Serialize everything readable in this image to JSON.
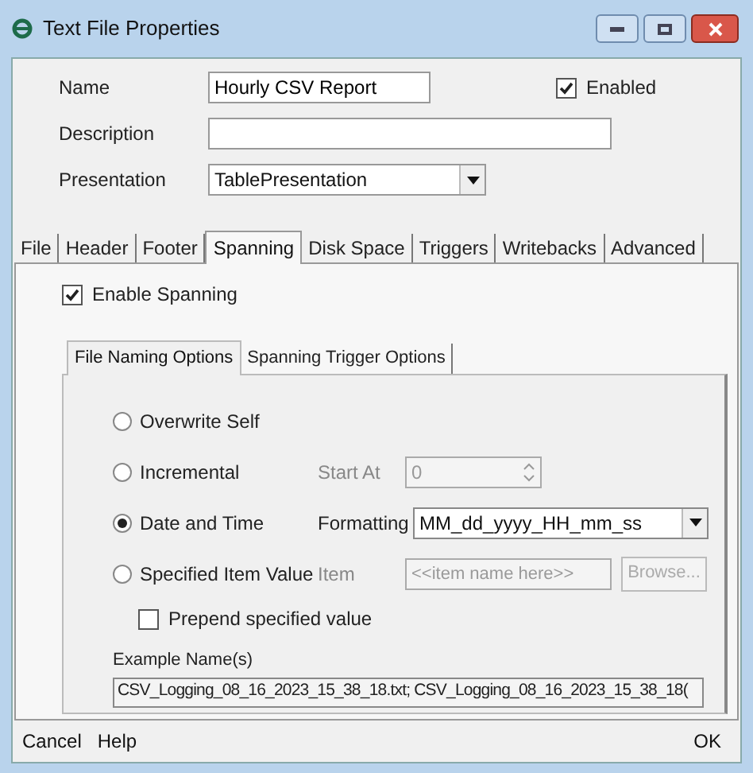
{
  "window": {
    "title": "Text File Properties"
  },
  "fields": {
    "name_label": "Name",
    "name_value": "Hourly CSV Report",
    "enabled_label": "Enabled",
    "enabled_checked": true,
    "description_label": "Description",
    "presentation_label": "Presentation",
    "presentation_value": "TablePresentation"
  },
  "tabs": [
    {
      "label": "File",
      "selected": false
    },
    {
      "label": "Header",
      "selected": false
    },
    {
      "label": "Footer",
      "selected": false
    },
    {
      "label": "Spanning",
      "selected": true
    },
    {
      "label": "Disk Space",
      "selected": false
    },
    {
      "label": "Triggers",
      "selected": false
    },
    {
      "label": "Writebacks",
      "selected": false
    },
    {
      "label": "Advanced",
      "selected": false
    }
  ],
  "enable_spanning": {
    "label": "Enable Spanning",
    "checked": true
  },
  "inner_tabs": [
    {
      "label": "File Naming Options",
      "selected": true
    },
    {
      "label": "Spanning Trigger Options",
      "selected": false
    }
  ],
  "naming_options": [
    {
      "label": "Overwrite Self",
      "selected": false,
      "kind": "none"
    },
    {
      "label": "Incremental",
      "selected": false,
      "kind": "spinner",
      "control_label": "Start At",
      "value": "0"
    },
    {
      "label": "Date and Time",
      "selected": true,
      "kind": "dropdown",
      "control_label": "Formatting",
      "value": "MM_dd_yyyy_HH_mm_ss"
    },
    {
      "label": "Specified Item Value",
      "selected": false,
      "kind": "item",
      "control_label": "Item",
      "placeholder": "<<item name here>>",
      "button": "Browse..."
    }
  ],
  "prepend": {
    "label": "Prepend specified value",
    "checked": false
  },
  "example": {
    "label": "Example Name(s)",
    "value": "CSV_Logging_08_16_2023_15_38_18.txt; CSV_Logging_08_16_2023_15_38_18("
  },
  "footer": {
    "cancel": "Cancel",
    "help": "Help",
    "ok": "OK"
  }
}
